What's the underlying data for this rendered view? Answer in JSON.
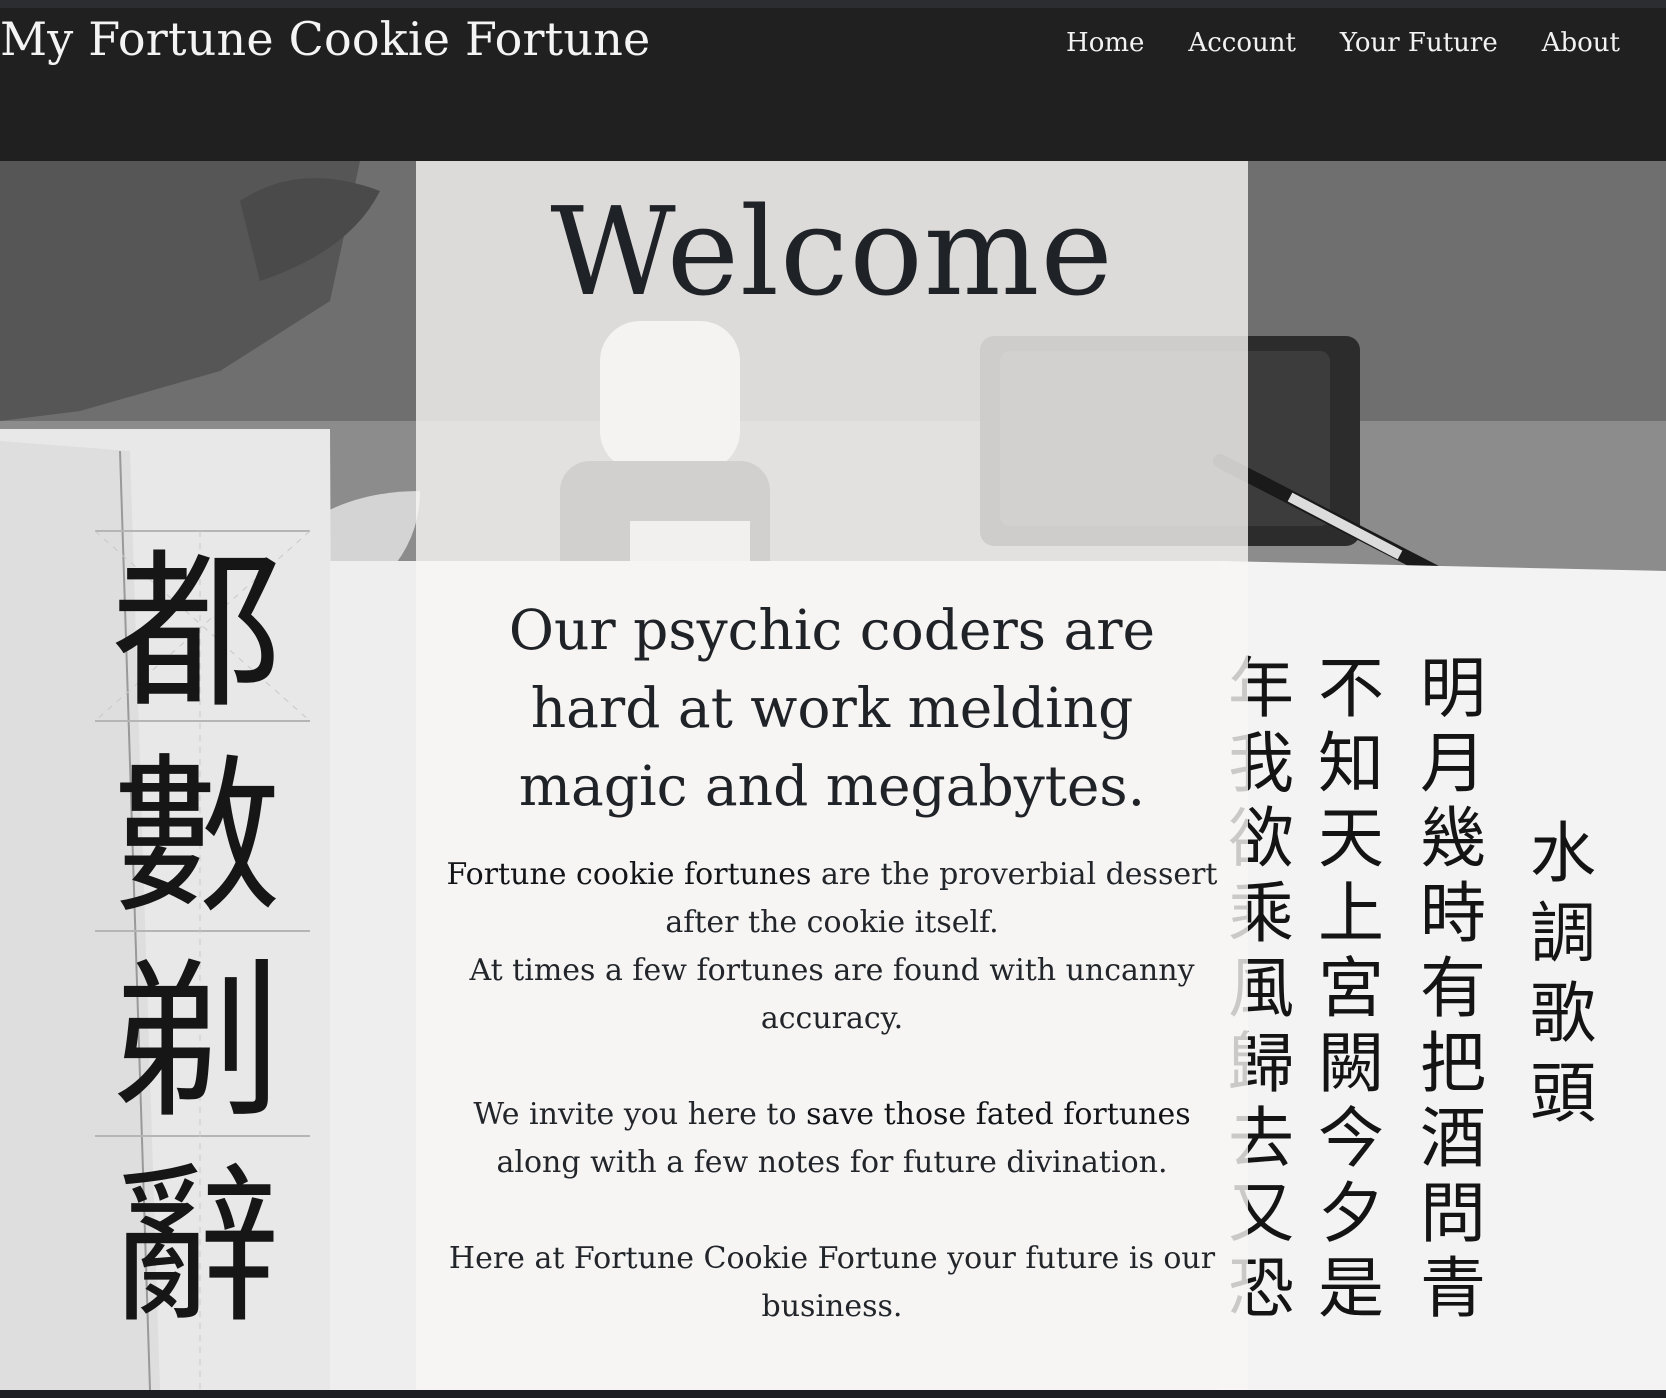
{
  "navbar": {
    "brand": "My Fortune Cookie Fortune",
    "links": [
      {
        "label": "Home"
      },
      {
        "label": "Account"
      },
      {
        "label": "Your Future"
      },
      {
        "label": "About"
      }
    ]
  },
  "hero": {
    "background": "calligraphy-practice-photo",
    "calligraphy_left": [
      "都",
      "數",
      "剃",
      "辭"
    ],
    "calligraphy_right_columns": [
      [
        "年",
        "我",
        "欲",
        "乘",
        "風",
        "歸",
        "去",
        "又",
        "恐"
      ],
      [
        "不",
        "知",
        "天",
        "上",
        "宮",
        "闕",
        "今",
        "夕",
        "是"
      ],
      [
        "明",
        "月",
        "幾",
        "時",
        "有",
        "把",
        "酒",
        "問",
        "青"
      ],
      [
        "水",
        "調",
        "歌",
        "頭"
      ]
    ]
  },
  "panel": {
    "welcome": "Welcome",
    "tagline": "Our psychic coders are hard at work melding magic and megabytes.",
    "para1": {
      "strong": "Fortune cookie fortunes",
      "rest": " are the proverbial dessert after the cookie itself."
    },
    "para2": "At times a few fortunes are found with uncanny accuracy.",
    "para3": {
      "before": "We invite you here to ",
      "strong": "save those fated fortunes",
      "after": " along with a few notes for future divination."
    },
    "para4": "Here at Fortune Cookie Fortune your future is our business."
  },
  "colors": {
    "navbar_bg": "#202020",
    "nav_text": "#f2f2f2",
    "panel_bg": "rgba(248,246,245,0.80)",
    "text": "#1f2226"
  }
}
